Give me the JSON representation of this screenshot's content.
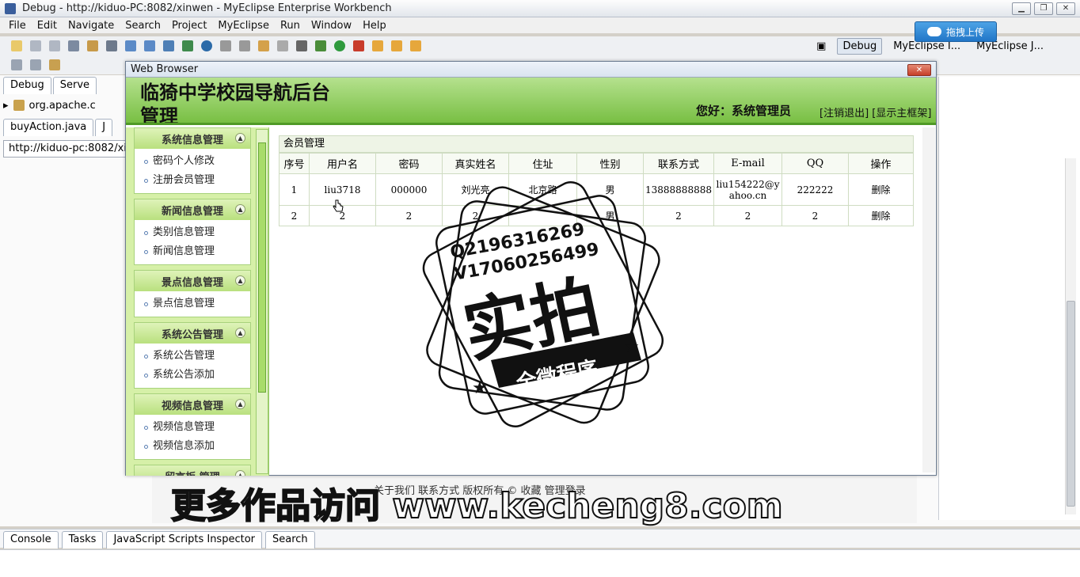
{
  "window": {
    "title": "Debug - http://kiduo-PC:8082/xinwen - MyEclipse Enterprise Workbench"
  },
  "menu": [
    "File",
    "Edit",
    "Navigate",
    "Search",
    "Project",
    "MyEclipse",
    "Run",
    "Window",
    "Help"
  ],
  "perspectives": [
    "Debug",
    "MyEclipse I...",
    "MyEclipse J..."
  ],
  "upload_label": "拖拽上传",
  "left_tabs": [
    "Debug",
    "Serve"
  ],
  "left_tree_item": "org.apache.c",
  "editor_tabs": [
    "buyAction.java",
    "J"
  ],
  "url": "http://kiduo-pc:8082/xinw",
  "browser": {
    "title": "Web Browser",
    "close": "✕"
  },
  "site": {
    "title": "临猗中学校园导航后台管理",
    "greeting": "您好：系统管理员",
    "logout": "[注销退出]",
    "show_frame": "[显示主框架]"
  },
  "nav": [
    {
      "title": "系统信息管理",
      "items": [
        "密码个人修改",
        "注册会员管理"
      ]
    },
    {
      "title": "新闻信息管理",
      "items": [
        "类别信息管理",
        "新闻信息管理"
      ]
    },
    {
      "title": "景点信息管理",
      "items": [
        "景点信息管理"
      ]
    },
    {
      "title": "系统公告管理",
      "items": [
        "系统公告管理",
        "系统公告添加"
      ]
    },
    {
      "title": "视频信息管理",
      "items": [
        "视频信息管理",
        "视频信息添加"
      ]
    },
    {
      "title": "留言板  管理",
      "items": []
    }
  ],
  "grid": {
    "caption": "会员管理",
    "headers": [
      "序号",
      "用户名",
      "密码",
      "真实姓名",
      "住址",
      "性别",
      "联系方式",
      "E-mail",
      "QQ",
      "操作"
    ],
    "rows": [
      [
        "1",
        "liu3718",
        "000000",
        "刘光亮",
        "北京路",
        "男",
        "13888888888",
        "liu154222@yahoo.cn",
        "222222",
        "删除"
      ],
      [
        "2",
        "2",
        "2",
        "2",
        "",
        "男",
        "2",
        "2",
        "2",
        "删除"
      ]
    ]
  },
  "stamp": {
    "line1": "Q2196316269",
    "line2": "V17060256499",
    "big": "实拍",
    "ribbon": "全微程序"
  },
  "watermark": "更多作品访问 www.kecheng8.com",
  "under_text": "关于我们  联系方式  版权所有  ©  收藏  管理登录",
  "console_tabs": [
    "Console",
    "Tasks",
    "JavaScript Scripts Inspector",
    "Search"
  ],
  "colors": {
    "header_green": "#78bf43",
    "nav_green": "#d6f0a8",
    "accent_blue": "#2176c7"
  }
}
